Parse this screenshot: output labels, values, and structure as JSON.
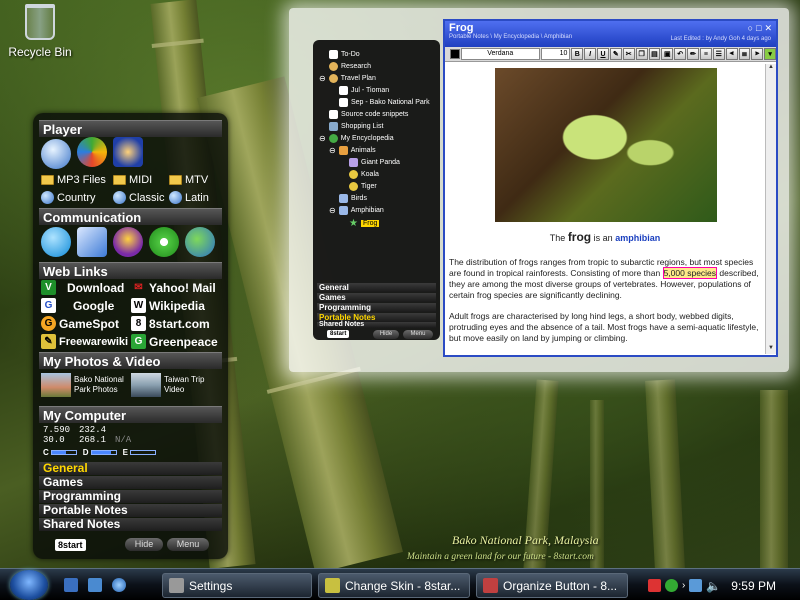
{
  "desktop": {
    "recycle_bin_label": "Recycle Bin"
  },
  "sidebar": {
    "player": {
      "title": "Player",
      "folders": [
        "MP3 Files",
        "MIDI",
        "MTV"
      ],
      "radios": [
        "Country",
        "Classic",
        "Latin"
      ]
    },
    "communication": {
      "title": "Communication"
    },
    "web_links": {
      "title": "Web Links",
      "items": [
        "Download",
        "Yahoo! Mail",
        "Google",
        "Wikipedia",
        "GameSpot",
        "8start.com",
        "Freewarewiki",
        "Greenpeace"
      ]
    },
    "photos": {
      "title": "My Photos & Video",
      "items": [
        "Bako National Park Photos",
        "Taiwan Trip Video"
      ]
    },
    "computer": {
      "title": "My Computer",
      "stats_row1": [
        "7.590",
        "232.4"
      ],
      "stats_row2": [
        "30.0",
        "268.1",
        "N/A"
      ],
      "drives": [
        {
          "letter": "C",
          "fill": 0.6
        },
        {
          "letter": "D",
          "fill": 0.8
        },
        {
          "letter": "E",
          "fill": 0.0
        }
      ]
    },
    "categories": [
      "General",
      "Games",
      "Programming",
      "Portable Notes",
      "Shared Notes"
    ],
    "active_category": "General",
    "logo": "8start",
    "hide_label": "Hide",
    "menu_label": "Menu"
  },
  "notes_tree": {
    "items": [
      "To-Do",
      "Research",
      "Travel Plan",
      "Jul - Tioman",
      "Sep - Bako National Park",
      "Source code snippets",
      "Shopping List",
      "My Encyclopedia",
      "Animals",
      "Giant Panda",
      "Koala",
      "Tiger",
      "Birds",
      "Amphibian",
      "Frog"
    ],
    "selected": "Frog",
    "categories": [
      "General",
      "Games",
      "Programming",
      "Portable Notes",
      "Shared Notes"
    ],
    "active_category": "Portable Notes",
    "logo": "8start",
    "hide_label": "Hide",
    "menu_label": "Menu"
  },
  "note_window": {
    "title": "Frog",
    "breadcrumb": "Portable Notes \\ My Encyclopedia \\ Amphibian",
    "last_edited": "Last Edited : by Andy Goh 4 days ago",
    "font_name": "Verdana",
    "font_size": "10",
    "heading_prefix": "The",
    "heading_word": "frog",
    "heading_mid": "is an",
    "heading_link": "amphibian",
    "para1_a": "The distribution of frogs ranges from tropic to subarctic regions, but most species are found in tropical rainforests. Consisting of more than",
    "para1_highlight": "5,000 species",
    "para1_b": "described, they are among the most diverse groups of vertebrates. However, populations of certain frog species are significantly declining.",
    "para2": "Adult frogs are characterised by long hind legs, a short body, webbed digits, protruding eyes and the absence of a tail. Most frogs have a semi-aquatic lifestyle, but move easily on land by jumping or climbing."
  },
  "caption": {
    "line1": "Bako National Park, Malaysia",
    "line2": "Maintain a green land for our future - 8start.com"
  },
  "taskbar": {
    "tasks": [
      "Settings",
      "Change Skin - 8star...",
      "Organize Button - 8..."
    ],
    "clock": "9:59 PM"
  },
  "colors": {
    "accent": "#2b4bc4",
    "active_category": "#ffd700",
    "link_blue": "#1a3fbf"
  }
}
